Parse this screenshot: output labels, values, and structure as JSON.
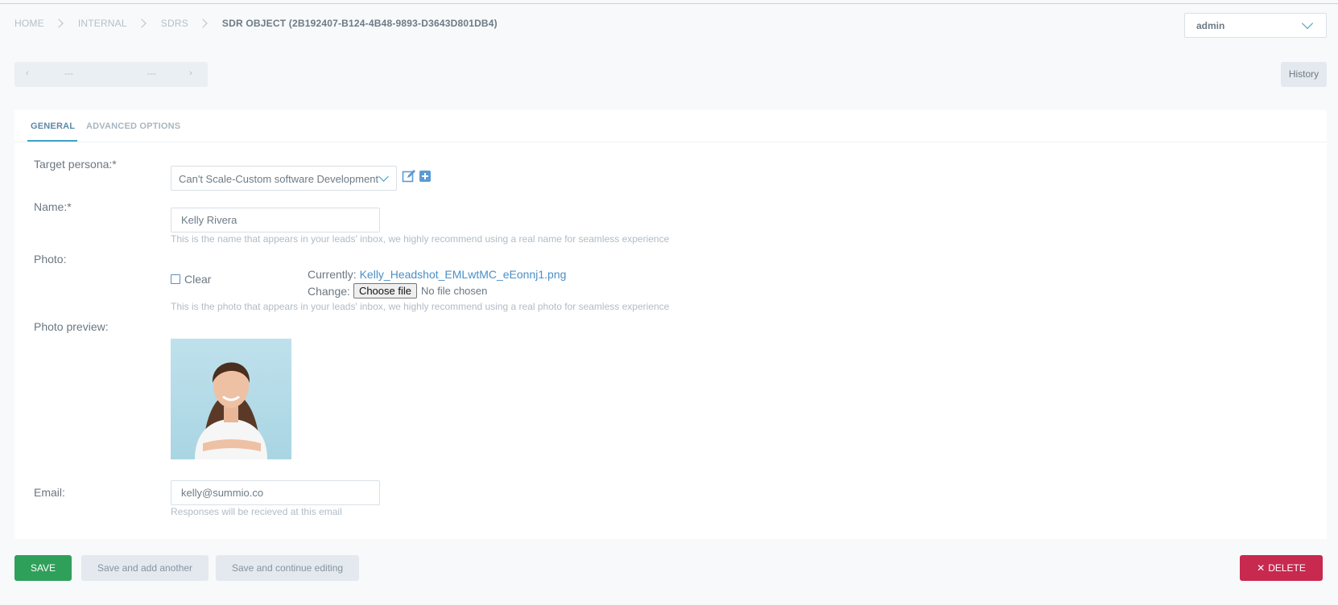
{
  "breadcrumb": {
    "items": [
      "HOME",
      "INTERNAL",
      "SDRS"
    ],
    "current": "SDR OBJECT (2B192407-B124-4B48-9893-D3643D801DB4)"
  },
  "user_menu": {
    "selected": "admin"
  },
  "pager": {
    "prev": "‹",
    "next": "›",
    "value_left": "---",
    "value_right": "---"
  },
  "history_label": "History",
  "tabs": [
    {
      "label": "GENERAL",
      "active": true
    },
    {
      "label": "ADVANCED OPTIONS",
      "active": false
    }
  ],
  "form": {
    "target_persona": {
      "label": "Target persona:*",
      "value": "Can't Scale-Custom software Development"
    },
    "name": {
      "label": "Name:*",
      "value": "Kelly Rivera",
      "help": "This is the name that appears in your leads' inbox, we highly recommend using a real name for seamless experience"
    },
    "photo": {
      "label": "Photo:",
      "clear_label": "Clear",
      "currently_label": "Currently:",
      "currently_file": "Kelly_Headshot_EMLwtMC_eEonnj1.png",
      "change_label": "Change:",
      "choose_file_label": "Choose file",
      "no_file_label": "No file chosen",
      "help": "This is the photo that appears in your leads' inbox, we highly recommend using a real photo for seamless experience"
    },
    "photo_preview": {
      "label": "Photo preview:"
    },
    "email": {
      "label": "Email:",
      "value": "kelly@summio.co",
      "help": "Responses will be recieved at this email"
    }
  },
  "actions": {
    "save": "SAVE",
    "save_add": "Save and add another",
    "save_continue": "Save and continue editing",
    "delete": "DELETE"
  },
  "colors": {
    "save": "#2fa05a",
    "delete": "#c8294f",
    "accent": "#3fa3c9",
    "link": "#4a8fc7"
  }
}
